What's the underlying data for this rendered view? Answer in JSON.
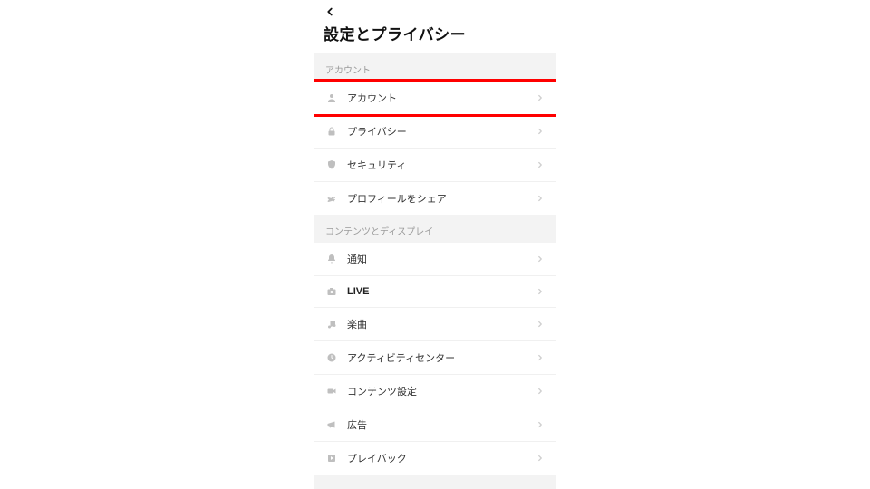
{
  "header": {
    "title": "設定とプライバシー"
  },
  "sections": {
    "account": {
      "label": "アカウント",
      "items": {
        "account": "アカウント",
        "privacy": "プライバシー",
        "security": "セキュリティ",
        "share_profile": "プロフィールをシェア"
      }
    },
    "content": {
      "label": "コンテンツとディスプレイ",
      "items": {
        "notifications": "通知",
        "live": "LIVE",
        "music": "楽曲",
        "activity_center": "アクティビティセンター",
        "content_settings": "コンテンツ設定",
        "ads": "広告",
        "playback": "プレイバック"
      }
    }
  },
  "highlight": {
    "target": "account-row"
  }
}
